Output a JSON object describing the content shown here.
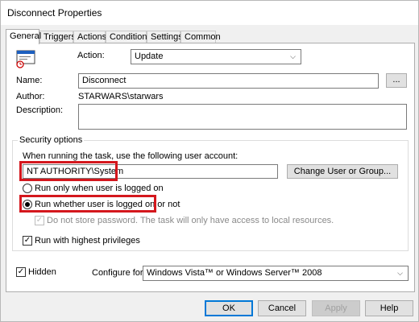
{
  "window": {
    "title": "Disconnect Properties"
  },
  "tabs": [
    {
      "label": "General"
    },
    {
      "label": "Triggers"
    },
    {
      "label": "Actions"
    },
    {
      "label": "Conditions"
    },
    {
      "label": "Settings"
    },
    {
      "label": "Common"
    }
  ],
  "general": {
    "action_label": "Action:",
    "action_value": "Update",
    "name_label": "Name:",
    "name_value": "Disconnect",
    "browse_label": "...",
    "author_label": "Author:",
    "author_value": "STARWARS\\starwars",
    "description_label": "Description:",
    "description_value": ""
  },
  "security": {
    "group_label": "Security options",
    "account_prompt": "When running the task, use the following user account:",
    "account_value": "NT AUTHORITY\\System",
    "change_user_label": "Change User or Group...",
    "radio_logged_on": "Run only when user is logged on",
    "radio_whether": "Run whether user is logged on or not",
    "dont_store_password": "Do not store password. The task will only have access to local resources.",
    "highest_privileges": "Run with highest privileges"
  },
  "bottom": {
    "hidden_label": "Hidden",
    "configure_for_label": "Configure for:",
    "configure_for_value": "Windows Vista™ or Windows Server™ 2008"
  },
  "buttons": {
    "ok": "OK",
    "cancel": "Cancel",
    "apply": "Apply",
    "help": "Help"
  },
  "colors": {
    "highlight": "#d4171d",
    "accent": "#0078d7"
  }
}
